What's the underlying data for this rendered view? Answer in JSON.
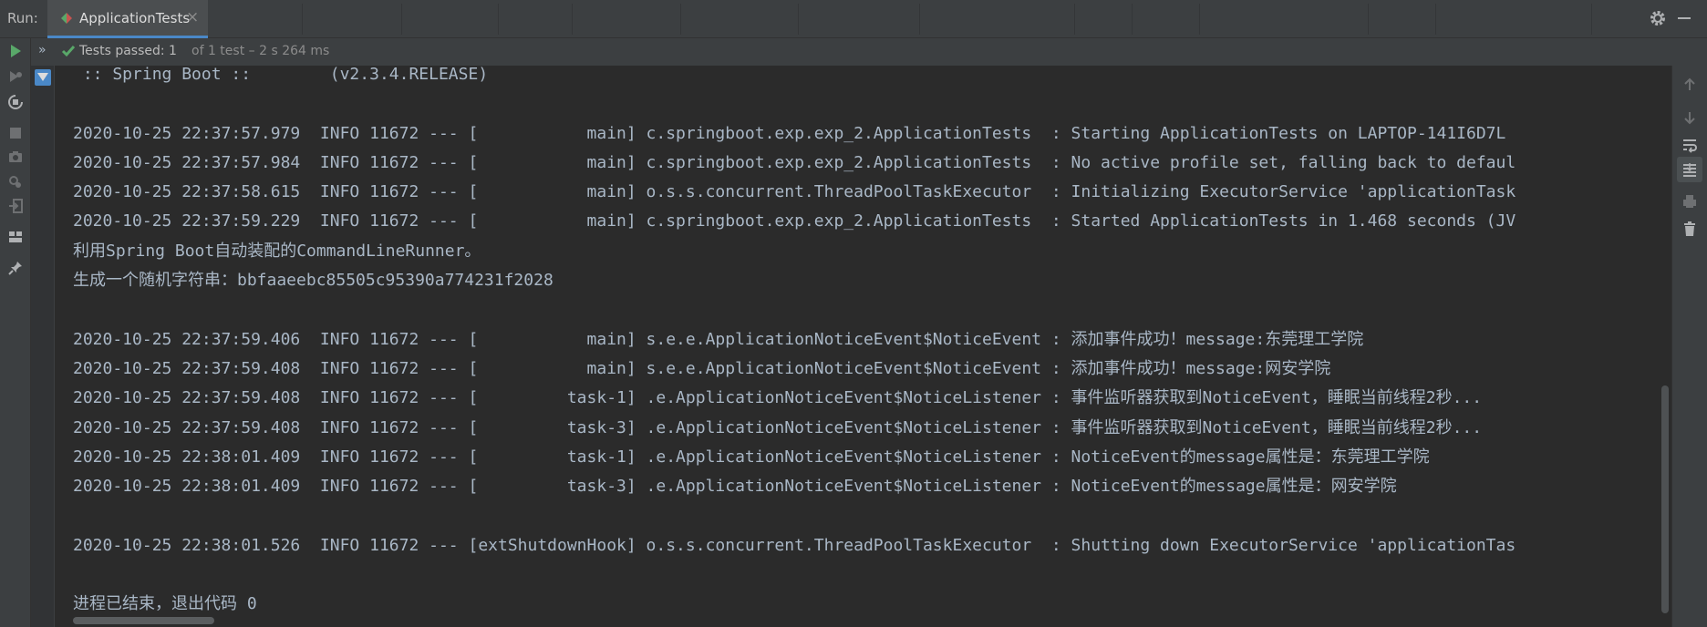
{
  "window": {
    "run_label": "Run:",
    "tab_title": "ApplicationTests",
    "tab_close": "×"
  },
  "status": {
    "chevron": "»",
    "label": "Tests passed: 1",
    "detail": "of 1 test – 2 s 264 ms"
  },
  "colors": {
    "background": "#2b2b2b",
    "toolbar": "#3c3f41",
    "console_text": "#a9b7c6",
    "pass_green": "#59a869",
    "accent_blue": "#4a88c7"
  },
  "icons": {
    "left_toolbar": [
      "rerun-icon",
      "rerun-failed-icon",
      "toggle-auto-test-icon",
      "stop-icon",
      "screenshot-icon",
      "settings-icon",
      "exit-icon",
      "layout-icon",
      "pin-icon"
    ],
    "right_toolbar": [
      "up-arrow-icon",
      "down-arrow-icon",
      "soft-wrap-icon",
      "scroll-to-end-icon",
      "print-icon",
      "trash-icon"
    ]
  },
  "console": {
    "lines": [
      " :: Spring Boot ::        (v2.3.4.RELEASE)",
      "",
      "2020-10-25 22:37:57.979  INFO 11672 --- [           main] c.springboot.exp.exp_2.ApplicationTests  : Starting ApplicationTests on LAPTOP-141I6D7L",
      "2020-10-25 22:37:57.984  INFO 11672 --- [           main] c.springboot.exp.exp_2.ApplicationTests  : No active profile set, falling back to defaul",
      "2020-10-25 22:37:58.615  INFO 11672 --- [           main] o.s.s.concurrent.ThreadPoolTaskExecutor  : Initializing ExecutorService 'applicationTask",
      "2020-10-25 22:37:59.229  INFO 11672 --- [           main] c.springboot.exp.exp_2.ApplicationTests  : Started ApplicationTests in 1.468 seconds (JV",
      "利用Spring Boot自动装配的CommandLineRunner。",
      "生成一个随机字符串：bbfaaeebc85505c95390a774231f2028",
      "",
      "2020-10-25 22:37:59.406  INFO 11672 --- [           main] s.e.e.ApplicationNoticeEvent$NoticeEvent : 添加事件成功！message:东莞理工学院",
      "2020-10-25 22:37:59.408  INFO 11672 --- [           main] s.e.e.ApplicationNoticeEvent$NoticeEvent : 添加事件成功！message:网安学院",
      "2020-10-25 22:37:59.408  INFO 11672 --- [         task-1] .e.ApplicationNoticeEvent$NoticeListener : 事件监听器获取到NoticeEvent，睡眠当前线程2秒...",
      "2020-10-25 22:37:59.408  INFO 11672 --- [         task-3] .e.ApplicationNoticeEvent$NoticeListener : 事件监听器获取到NoticeEvent，睡眠当前线程2秒...",
      "2020-10-25 22:38:01.409  INFO 11672 --- [         task-1] .e.ApplicationNoticeEvent$NoticeListener : NoticeEvent的message属性是：东莞理工学院",
      "2020-10-25 22:38:01.409  INFO 11672 --- [         task-3] .e.ApplicationNoticeEvent$NoticeListener : NoticeEvent的message属性是：网安学院",
      "",
      "2020-10-25 22:38:01.526  INFO 11672 --- [extShutdownHook] o.s.s.concurrent.ThreadPoolTaskExecutor  : Shutting down ExecutorService 'applicationTas",
      "",
      "进程已结束，退出代码 0"
    ]
  }
}
